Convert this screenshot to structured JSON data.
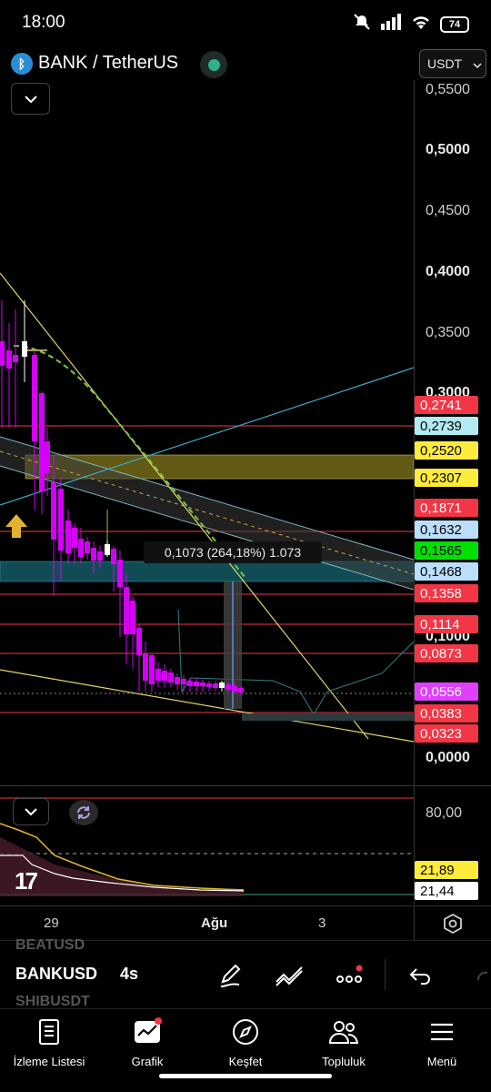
{
  "status": {
    "time": "18:00",
    "battery": "74",
    "icons": [
      "mute-icon",
      "signal-icon",
      "wifi-icon",
      "battery-icon"
    ]
  },
  "symbol": {
    "title": "BANK / TetherUS",
    "currency": "USDT",
    "logo_glyph": "ᛒ"
  },
  "price_axis": {
    "labels": [
      "0,5500",
      "0,5000",
      "0,4500",
      "0,4000",
      "0,3500",
      "0,3000",
      "0,1000",
      "0,0000"
    ],
    "bold_labels": [
      "0,5000",
      "0,4000",
      "0,3000",
      "0,1000",
      "0,0000"
    ]
  },
  "price_tags": [
    {
      "value": "0,2741",
      "bg": "#f23645",
      "fg": "#ffffff"
    },
    {
      "value": "0,2739",
      "bg": "#b2ebf2",
      "fg": "#000000"
    },
    {
      "value": "0,2520",
      "bg": "#ffeb3b",
      "fg": "#000000"
    },
    {
      "value": "0,2307",
      "bg": "#ffeb3b",
      "fg": "#000000"
    },
    {
      "value": "0,1871",
      "bg": "#f23645",
      "fg": "#ffffff"
    },
    {
      "value": "0,1632",
      "bg": "#bbdefb",
      "fg": "#000000"
    },
    {
      "value": "0,1565",
      "bg": "#00e000",
      "fg": "#000000"
    },
    {
      "value": "0,1468",
      "bg": "#bbdefb",
      "fg": "#000000"
    },
    {
      "value": "0,1358",
      "bg": "#f23645",
      "fg": "#ffffff"
    },
    {
      "value": "0,1114",
      "bg": "#f23645",
      "fg": "#ffffff"
    },
    {
      "value": "0,0873",
      "bg": "#f23645",
      "fg": "#ffffff"
    },
    {
      "value": "0,0556",
      "bg": "#e040fb",
      "fg": "#ffffff"
    },
    {
      "value": "0,0383",
      "bg": "#f23645",
      "fg": "#ffffff"
    },
    {
      "value": "0,0323",
      "bg": "#f23645",
      "fg": "#ffffff"
    }
  ],
  "measure": {
    "text": "0,1073 (264,18%) 1.073"
  },
  "indicator": {
    "axis_label": "80,00",
    "tags": [
      {
        "value": "21,89",
        "bg": "#ffeb3b",
        "fg": "#000000"
      },
      {
        "value": "21,44",
        "bg": "#ffffff",
        "fg": "#000000"
      }
    ],
    "logo": "17"
  },
  "time_axis": {
    "labels": [
      "29",
      "Ağu",
      "3"
    ],
    "bold_labels": [
      "Ağu"
    ]
  },
  "toolbar": {
    "ticker_prev": "BEATUSD",
    "ticker": "BANKUSD",
    "ticker_next": "SHIBUSDT",
    "interval": "4s",
    "tools": [
      "pencil-icon",
      "trend-lines-icon",
      "more-tools-icon",
      "undo-icon"
    ]
  },
  "nav": [
    {
      "label": "İzleme Listesi",
      "icon": "watchlist-icon"
    },
    {
      "label": "Grafik",
      "icon": "chart-icon"
    },
    {
      "label": "Keşfet",
      "icon": "compass-icon"
    },
    {
      "label": "Topluluk",
      "icon": "community-icon"
    },
    {
      "label": "Menü",
      "icon": "menu-icon"
    }
  ],
  "colors": {
    "candle": "#d500f9",
    "candle_up": "#ffffff",
    "red_line": "#f23645",
    "zone_yellow": "#6b6316",
    "zone_teal": "#114c55",
    "trend_yellow": "#e0d36a",
    "trend_cyan": "#3fa9c9",
    "ma_green": "#7cc742"
  }
}
